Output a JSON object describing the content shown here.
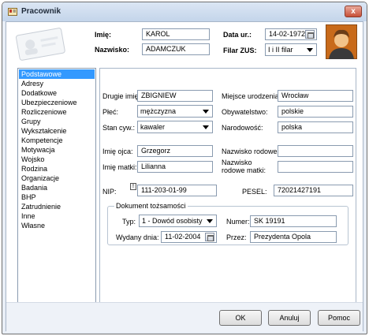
{
  "window": {
    "title": "Pracownik",
    "close_label": "x"
  },
  "header": {
    "imie_label": "Imię:",
    "imie_value": "KAROL",
    "nazwisko_label": "Nazwisko:",
    "nazwisko_value": "ADAMCZUK",
    "data_ur_label": "Data ur.:",
    "data_ur_value": "14-02-1972",
    "filar_label": "Filar ZUS:",
    "filar_value": "I i II filar"
  },
  "sidebar": {
    "items": [
      {
        "label": "Podstawowe",
        "selected": true
      },
      {
        "label": "Adresy"
      },
      {
        "label": "Dodatkowe"
      },
      {
        "label": "Ubezpieczeniowe"
      },
      {
        "label": "Rozliczeniowe"
      },
      {
        "label": "Grupy"
      },
      {
        "label": "Wykształcenie"
      },
      {
        "label": "Kompetencje"
      },
      {
        "label": "Motywacja"
      },
      {
        "label": "Wojsko"
      },
      {
        "label": "Rodzina"
      },
      {
        "label": "Organizacje"
      },
      {
        "label": "Badania"
      },
      {
        "label": "BHP"
      },
      {
        "label": "Zatrudnienie"
      },
      {
        "label": "Inne"
      },
      {
        "label": "Własne"
      }
    ]
  },
  "form": {
    "drugie_imie_label": "Drugie imię:",
    "drugie_imie_value": "ZBIGNIEW",
    "plec_label": "Płeć:",
    "plec_value": "mężczyzna",
    "stan_label": "Stan cyw.:",
    "stan_value": "kawaler",
    "miejsce_label": "Miejsce urodzenia:",
    "miejsce_value": "Wrocław",
    "obyw_label": "Obywatelstwo:",
    "obyw_value": "polskie",
    "narod_label": "Narodowość:",
    "narod_value": "polska",
    "imie_ojca_label": "Imię ojca:",
    "imie_ojca_value": "Grzegorz",
    "imie_matki_label": "Imię matki:",
    "imie_matki_value": "Lilianna",
    "nazw_rod_label": "Nazwisko rodowe:",
    "nazw_rod_value": "",
    "nazw_rod_matki_label_1": "Nazwisko",
    "nazw_rod_matki_label_2": "rodowe matki:",
    "nazw_rod_matki_value": "",
    "nip_label": "NIP:",
    "nip_value": "111-203-01-99",
    "pesel_label": "PESEL:",
    "pesel_value": "72021427191"
  },
  "dokument": {
    "title": "Dokument tożsamości",
    "typ_label": "Typ:",
    "typ_value": "1 - Dowód osobisty",
    "wydany_label": "Wydany dnia:",
    "wydany_value": "11-02-2004",
    "numer_label": "Numer:",
    "numer_value": "SK 19191",
    "przez_label": "Przez:",
    "przez_value": "Prezydenta Opola"
  },
  "buttons": {
    "ok": "OK",
    "anuluj": "Anuluj",
    "pomoc": "Pomoc"
  },
  "colors": {
    "selection": "#3399ff",
    "window_bg": "#e8eef6"
  }
}
